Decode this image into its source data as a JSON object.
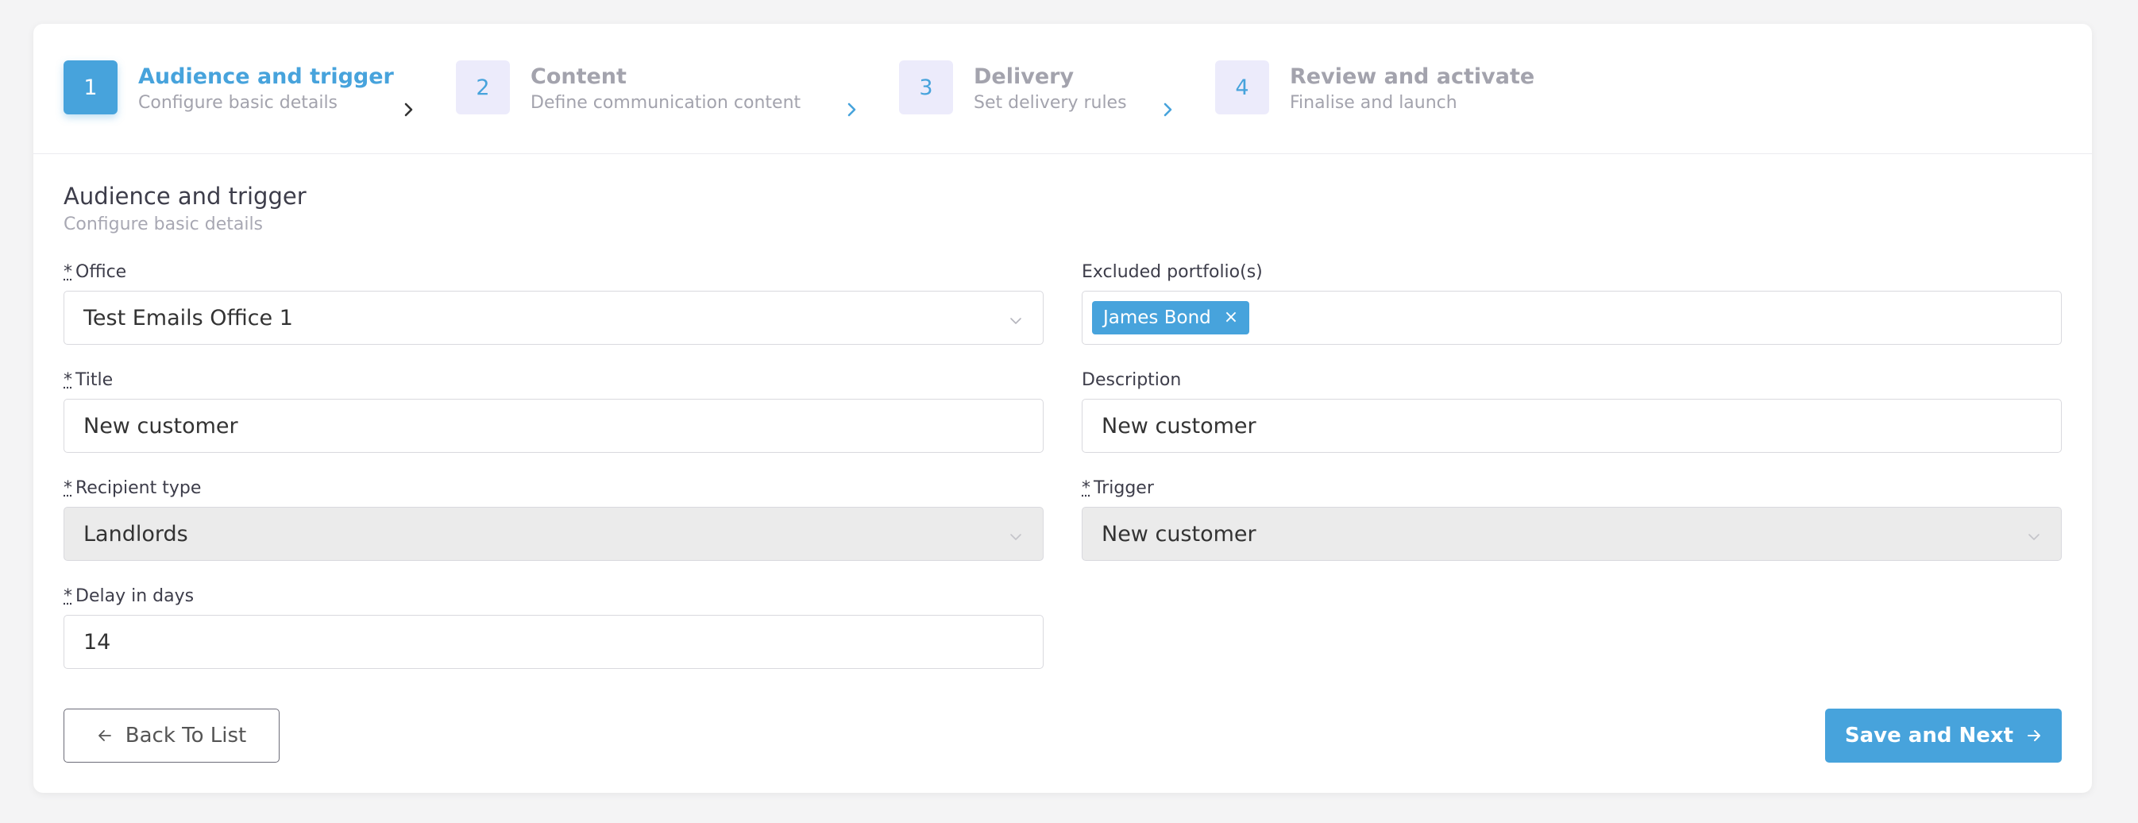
{
  "stepper": {
    "steps": [
      {
        "number": "1",
        "title": "Audience and trigger",
        "subtitle": "Configure basic details",
        "active": true
      },
      {
        "number": "2",
        "title": "Content",
        "subtitle": "Define communication content",
        "active": false
      },
      {
        "number": "3",
        "title": "Delivery",
        "subtitle": "Set delivery rules",
        "active": false
      },
      {
        "number": "4",
        "title": "Review and activate",
        "subtitle": "Finalise and launch",
        "active": false
      }
    ]
  },
  "section": {
    "title": "Audience and trigger",
    "subtitle": "Configure basic details"
  },
  "form": {
    "required_marker": "*",
    "office": {
      "label": "Office",
      "value": "Test Emails Office 1"
    },
    "excluded_portfolios": {
      "label": "Excluded portfolio(s)",
      "tags": [
        "James Bond"
      ],
      "tag_close": "×"
    },
    "title": {
      "label": "Title",
      "value": "New customer"
    },
    "description": {
      "label": "Description",
      "value": "New customer"
    },
    "recipient_type": {
      "label": "Recipient type",
      "value": "Landlords"
    },
    "trigger": {
      "label": "Trigger",
      "value": "New customer"
    },
    "delay": {
      "label": "Delay in days",
      "value": "14"
    }
  },
  "actions": {
    "back_label": "Back To List",
    "next_label": "Save and Next"
  },
  "colors": {
    "accent": "#47a3dc",
    "step_inactive_bg": "#ecebfb",
    "disabled_bg": "#ebebeb"
  },
  "icons": {
    "step_separator": "chevron-right-icon",
    "select_caret": "chevron-down-icon",
    "back": "arrow-left-icon",
    "next": "arrow-right-icon"
  }
}
